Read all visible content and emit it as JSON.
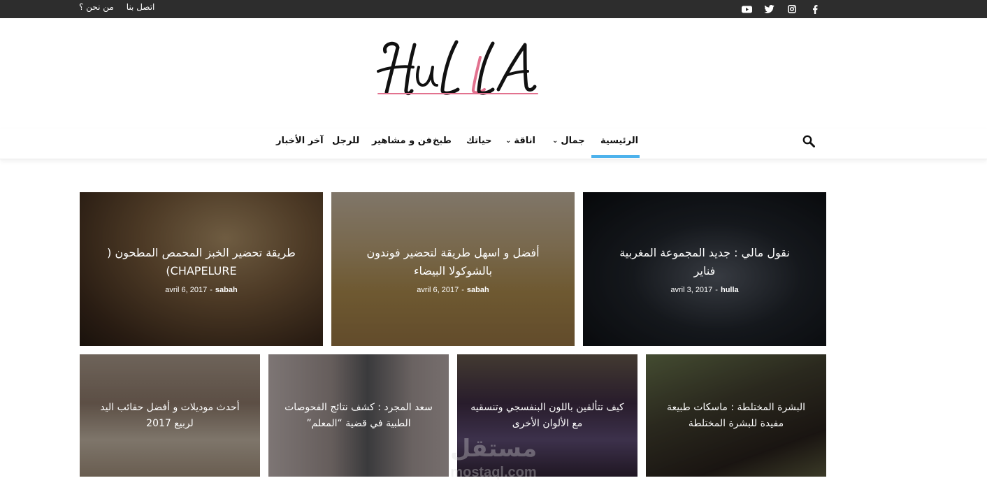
{
  "topbar": {
    "links": [
      "من نحن ؟",
      "اتصل بنا"
    ],
    "social_icons": [
      "facebook-icon",
      "instagram-icon",
      "twitter-icon",
      "youtube-icon"
    ],
    "bg_color": "#2d2d2d"
  },
  "logo": {
    "text": "HULLA",
    "accent_color": "#e2728f"
  },
  "nav": {
    "items": [
      {
        "label": "الرئيسية",
        "active": true
      },
      {
        "label": "جمال",
        "dropdown": true
      },
      {
        "label": "اناقة",
        "dropdown": true
      },
      {
        "label": "حياتك"
      },
      {
        "label": "طبخ"
      },
      {
        "label": "فن و مشاهير"
      },
      {
        "label": "للرجل"
      },
      {
        "label": "آخر الأخبار"
      }
    ],
    "active_color": "#4db2ec",
    "search_icon": "search-icon"
  },
  "featured": [
    {
      "title": "نقول مالي : جديد المجموعة المغربية فناير",
      "date": "avril 3, 2017",
      "author": "hulla"
    },
    {
      "title": "أفضل و اسهل طريقة لتحضير فوندون بالشوكولا البيضاء",
      "date": "avril 6, 2017",
      "author": "sabah"
    },
    {
      "title": "طريقة تحضير الخبز المحمص المطحون ( CHAPELURE)",
      "date": "avril 6, 2017",
      "author": "sabah"
    }
  ],
  "secondary": [
    {
      "title": "البشرة المختلطة : ماسكات طبيعة مفيدة للبشرة المختلطة"
    },
    {
      "title": "كيف تتألقين باللون البنفسجي وتنسقيه مع الألوان الأخرى"
    },
    {
      "title": "سعد المجرد : كشف نتائج الفحوصات الطبية في قضية “المعلم”"
    },
    {
      "title": "أحدث موديلات و أفضل حقائب اليد لربيع 2017"
    }
  ],
  "watermark": {
    "arabic": "مستقل",
    "latin": "mostaql.com"
  }
}
